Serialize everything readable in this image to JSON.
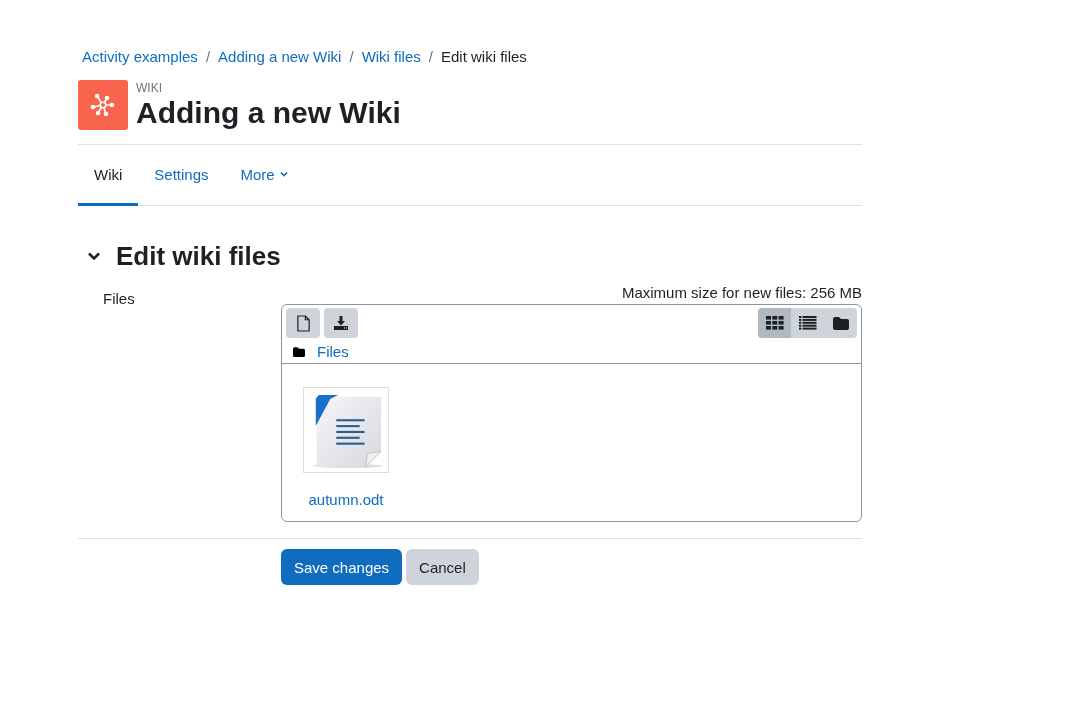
{
  "breadcrumb": [
    {
      "label": "Activity examples",
      "link": true
    },
    {
      "separator": "/",
      "label": "Adding a new Wiki",
      "link": true
    },
    {
      "separator": "/",
      "label": "Wiki files",
      "link": true
    },
    {
      "separator": "/",
      "label": "Edit wiki files",
      "link": false
    }
  ],
  "header": {
    "module": "WIKI",
    "title": "Adding a new Wiki"
  },
  "tabs": [
    {
      "label": "Wiki",
      "selected": true,
      "dropdown": false
    },
    {
      "label": "Settings",
      "selected": false,
      "dropdown": false
    },
    {
      "label": "More",
      "selected": false,
      "dropdown": true
    }
  ],
  "section": {
    "title": "Edit wiki files",
    "expanded": true
  },
  "field": {
    "label": "Files",
    "max_size": "Maximum size for new files: 256 MB"
  },
  "view_modes": [
    {
      "kind": "icons",
      "selected": true
    },
    {
      "kind": "list",
      "selected": false
    },
    {
      "kind": "tree",
      "selected": false
    }
  ],
  "path": "Files",
  "files": [
    {
      "name": "autumn.odt"
    }
  ],
  "buttons": [
    {
      "label": "Save changes",
      "kind": "primary"
    },
    {
      "label": "Cancel",
      "kind": "secondary"
    }
  ]
}
